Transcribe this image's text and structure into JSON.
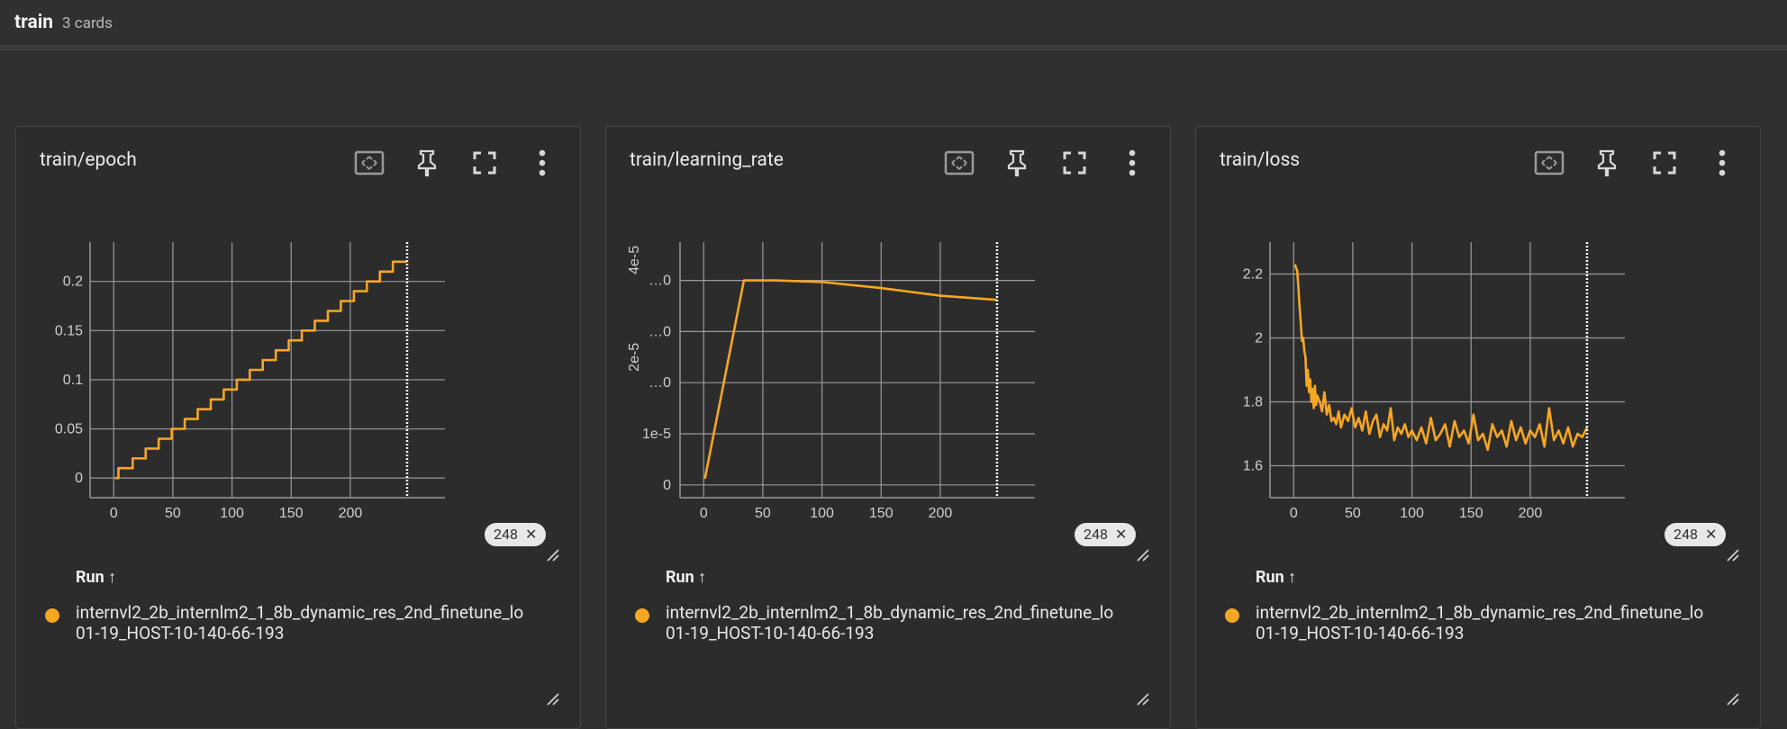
{
  "header": {
    "title": "train",
    "count": "3 cards"
  },
  "theme": {
    "accent": "#f5a623",
    "grid": "#9a9a9a",
    "background": "#2c2c2c"
  },
  "icons": [
    "fit-domain-icon",
    "pin-icon",
    "fullscreen-icon",
    "more-vert-icon",
    "resize-icon",
    "close-icon"
  ],
  "cards": [
    {
      "title": "train/epoch",
      "step_chip": "248",
      "run_header": "Run ↑",
      "run_name_line1": "internvl2_2b_internlm2_1_8b_dynamic_res_2nd_finetune_lo",
      "run_name_line2": "01-19_HOST-10-140-66-193"
    },
    {
      "title": "train/learning_rate",
      "step_chip": "248",
      "run_header": "Run ↑",
      "run_name_line1": "internvl2_2b_internlm2_1_8b_dynamic_res_2nd_finetune_lo",
      "run_name_line2": "01-19_HOST-10-140-66-193"
    },
    {
      "title": "train/loss",
      "step_chip": "248",
      "run_header": "Run ↑",
      "run_name_line1": "internvl2_2b_internlm2_1_8b_dynamic_res_2nd_finetune_lo",
      "run_name_line2": "01-19_HOST-10-140-66-193"
    }
  ],
  "chart_data": [
    {
      "type": "line",
      "title": "train/epoch",
      "x_ticks": [
        "0",
        "50",
        "100",
        "150",
        "200"
      ],
      "y_ticks": [
        "0",
        "0.05",
        "0.1",
        "0.15",
        "0.2"
      ],
      "xlim": [
        -20,
        280
      ],
      "ylim": [
        -0.02,
        0.24
      ],
      "marker_step": 248,
      "grid": true,
      "series": [
        {
          "x": [
            1,
            4,
            4,
            16,
            16,
            27,
            27,
            38,
            38,
            49,
            49,
            60,
            60,
            71,
            71,
            82,
            82,
            93,
            93,
            104,
            104,
            115,
            115,
            126,
            126,
            137,
            137,
            148,
            148,
            159,
            159,
            170,
            170,
            181,
            181,
            192,
            192,
            203,
            203,
            214,
            214,
            225,
            225,
            236,
            236,
            248
          ],
          "y": [
            0,
            0,
            0.01,
            0.01,
            0.02,
            0.02,
            0.03,
            0.03,
            0.04,
            0.04,
            0.05,
            0.05,
            0.06,
            0.06,
            0.07,
            0.07,
            0.08,
            0.08,
            0.09,
            0.09,
            0.1,
            0.1,
            0.11,
            0.11,
            0.12,
            0.12,
            0.13,
            0.13,
            0.14,
            0.14,
            0.15,
            0.15,
            0.16,
            0.16,
            0.17,
            0.17,
            0.18,
            0.18,
            0.19,
            0.19,
            0.2,
            0.2,
            0.21,
            0.21,
            0.22,
            0.22
          ]
        }
      ]
    },
    {
      "type": "line",
      "title": "train/learning_rate",
      "x_ticks": [
        "0",
        "50",
        "100",
        "150",
        "200"
      ],
      "y_ticks": [
        "0",
        "…0",
        "1e-5",
        "…0",
        "2e-5",
        "…0",
        "4e-5",
        "…0"
      ],
      "xlim": [
        -20,
        280
      ],
      "ylim": [
        -2.5e-06,
        4.75e-05
      ],
      "marker_step": 248,
      "grid": true,
      "series": [
        {
          "x": [
            1,
            34,
            60,
            100,
            150,
            200,
            248
          ],
          "y": [
            1.2e-06,
            4e-05,
            4e-05,
            3.97e-05,
            3.85e-05,
            3.7e-05,
            3.62e-05
          ]
        }
      ]
    },
    {
      "type": "line",
      "title": "train/loss",
      "x_ticks": [
        "0",
        "50",
        "100",
        "150",
        "200"
      ],
      "y_ticks": [
        "1.6",
        "1.8",
        "2",
        "2.2"
      ],
      "xlim": [
        -20,
        280
      ],
      "ylim": [
        1.5,
        2.3
      ],
      "marker_step": 248,
      "grid": true,
      "series": [
        {
          "x": [
            1,
            2,
            3,
            4,
            5,
            6,
            7,
            8,
            9,
            10,
            11,
            12,
            13,
            14,
            15,
            16,
            17,
            18,
            19,
            20,
            22,
            24,
            26,
            28,
            30,
            32,
            34,
            36,
            38,
            40,
            43,
            46,
            49,
            52,
            55,
            58,
            61,
            64,
            67,
            70,
            73,
            76,
            79,
            82,
            85,
            88,
            91,
            94,
            97,
            100,
            104,
            108,
            112,
            116,
            120,
            124,
            128,
            132,
            136,
            140,
            144,
            148,
            152,
            156,
            160,
            164,
            168,
            172,
            176,
            180,
            184,
            188,
            192,
            196,
            200,
            204,
            208,
            212,
            216,
            220,
            224,
            228,
            232,
            236,
            240,
            244,
            248
          ],
          "y": [
            2.23,
            2.22,
            2.21,
            2.16,
            2.1,
            2.05,
            1.99,
            2.0,
            1.96,
            1.94,
            1.85,
            1.9,
            1.83,
            1.87,
            1.8,
            1.84,
            1.78,
            1.85,
            1.79,
            1.82,
            1.8,
            1.77,
            1.83,
            1.76,
            1.79,
            1.74,
            1.75,
            1.73,
            1.77,
            1.72,
            1.76,
            1.74,
            1.78,
            1.72,
            1.75,
            1.71,
            1.77,
            1.7,
            1.74,
            1.76,
            1.69,
            1.73,
            1.71,
            1.78,
            1.68,
            1.72,
            1.7,
            1.73,
            1.69,
            1.71,
            1.68,
            1.72,
            1.67,
            1.75,
            1.68,
            1.7,
            1.73,
            1.66,
            1.74,
            1.69,
            1.71,
            1.67,
            1.76,
            1.68,
            1.7,
            1.65,
            1.73,
            1.69,
            1.71,
            1.66,
            1.74,
            1.68,
            1.72,
            1.67,
            1.71,
            1.69,
            1.73,
            1.66,
            1.78,
            1.68,
            1.71,
            1.67,
            1.72,
            1.66,
            1.7,
            1.69,
            1.72
          ]
        }
      ]
    }
  ]
}
